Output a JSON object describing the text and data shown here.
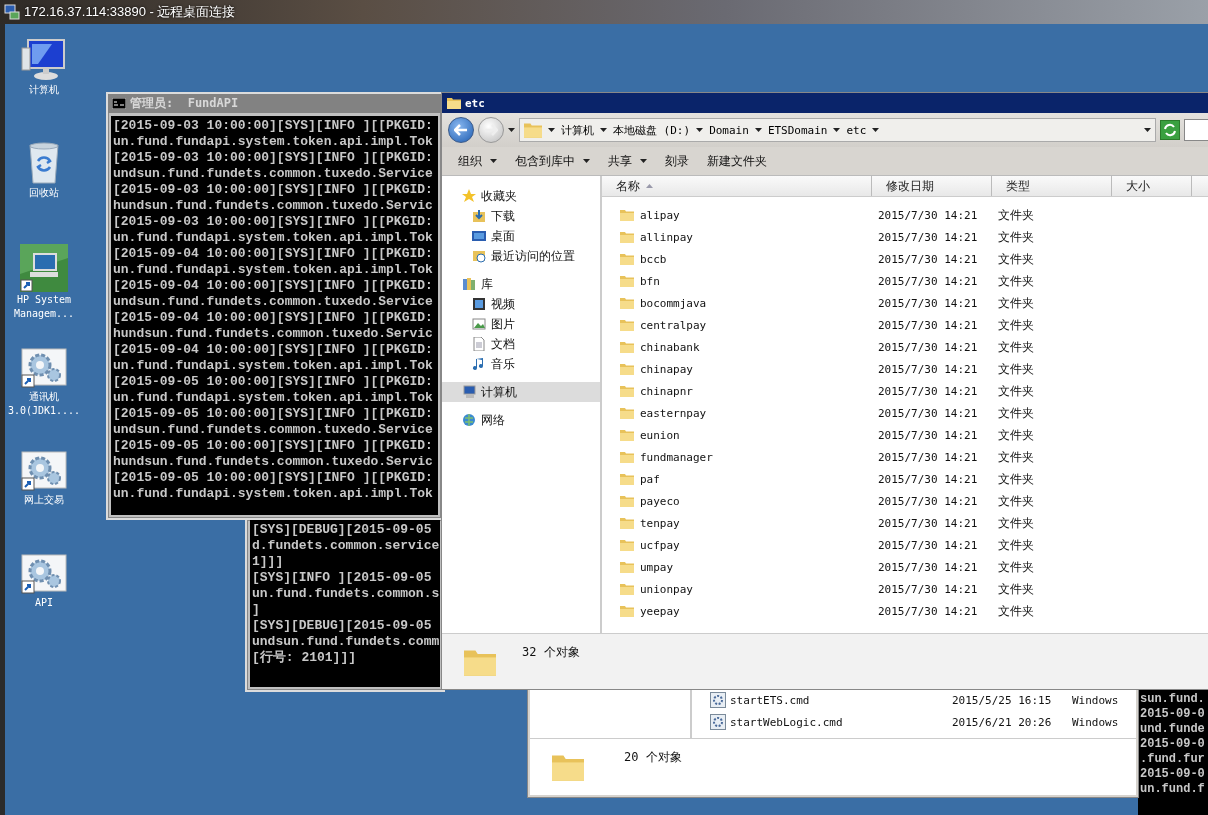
{
  "window": {
    "title": "172.16.37.114:33890 - 远程桌面连接"
  },
  "desktop_icons": [
    {
      "kind": "computer",
      "lines": [
        "计算机"
      ]
    },
    {
      "kind": "recycle",
      "lines": [
        "回收站"
      ]
    },
    {
      "kind": "hp",
      "lines": [
        "HP System",
        "Managem..."
      ]
    },
    {
      "kind": "gears",
      "lines": [
        "通讯机",
        "3.0(JDK1...."
      ]
    },
    {
      "kind": "gears",
      "lines": [
        "网上交易"
      ]
    },
    {
      "kind": "gears",
      "lines": [
        "API"
      ]
    }
  ],
  "console_back": {
    "lines": [
      "[SYS][DEBUG][2015-09-05",
      "d.fundets.common.service",
      "1]]]",
      "[SYS][INFO ][2015-09-05",
      "un.fund.fundets.common.s",
      "]",
      "[SYS][DEBUG][2015-09-05",
      "undsun.fund.fundets.comm",
      "[行号: 2101]]]"
    ]
  },
  "console_right": {
    "lines": [
      "sun.fund.",
      "2015-09-0",
      "und.funde",
      "2015-09-0",
      ".fund.fur",
      "2015-09-0",
      "un.fund.f"
    ]
  },
  "explorer_back": {
    "rows": [
      {
        "name": "startETS.cmd",
        "date": "2015/5/25 16:15",
        "type": "Windows"
      },
      {
        "name": "startWebLogic.cmd",
        "date": "2015/6/21 20:26",
        "type": "Windows"
      }
    ],
    "status": "20 个对象"
  },
  "console": {
    "title": "管理员:  FundAPI",
    "lines": [
      "[2015-09-03 10:00:00][SYS][INFO ][[PKGID:",
      "un.fund.fundapi.system.token.api.impl.Tok",
      "[2015-09-03 10:00:00][SYS][INFO ][[PKGID:",
      "undsun.fund.fundets.common.tuxedo.Service",
      "[2015-09-03 10:00:00][SYS][INFO ][[PKGID:",
      "hundsun.fund.fundets.common.tuxedo.Servic",
      "[2015-09-03 10:00:00][SYS][INFO ][[PKGID:",
      "un.fund.fundapi.system.token.api.impl.Tok",
      "[2015-09-04 10:00:00][SYS][INFO ][[PKGID:",
      "un.fund.fundapi.system.token.api.impl.Tok",
      "[2015-09-04 10:00:00][SYS][INFO ][[PKGID:",
      "undsun.fund.fundets.common.tuxedo.Service",
      "[2015-09-04 10:00:00][SYS][INFO ][[PKGID:",
      "hundsun.fund.fundets.common.tuxedo.Servic",
      "[2015-09-04 10:00:00][SYS][INFO ][[PKGID:",
      "un.fund.fundapi.system.token.api.impl.Tok",
      "[2015-09-05 10:00:00][SYS][INFO ][[PKGID:",
      "un.fund.fundapi.system.token.api.impl.Tok",
      "[2015-09-05 10:00:00][SYS][INFO ][[PKGID:",
      "undsun.fund.fundets.common.tuxedo.Service",
      "[2015-09-05 10:00:00][SYS][INFO ][[PKGID:",
      "hundsun.fund.fundets.common.tuxedo.Servic",
      "[2015-09-05 10:00:00][SYS][INFO ][[PKGID:",
      "un.fund.fundapi.system.token.api.impl.Tok"
    ]
  },
  "explorer": {
    "title": "etc",
    "breadcrumbs": [
      "计算机",
      "本地磁盘 (D:)",
      "Domain",
      "ETSDomain",
      "etc"
    ],
    "toolbar": [
      {
        "label": "组织",
        "dropdown": true
      },
      {
        "label": "包含到库中",
        "dropdown": true
      },
      {
        "label": "共享",
        "dropdown": true
      },
      {
        "label": "刻录",
        "dropdown": false
      },
      {
        "label": "新建文件夹",
        "dropdown": false
      }
    ],
    "nav": [
      {
        "kind": "star",
        "label": "收藏夹",
        "selected": false,
        "children": [
          {
            "kind": "download",
            "label": "下载",
            "selected": false
          },
          {
            "kind": "desktop",
            "label": "桌面",
            "selected": false
          },
          {
            "kind": "recent",
            "label": "最近访问的位置",
            "selected": false
          }
        ]
      },
      {
        "kind": "library",
        "label": "库",
        "selected": false,
        "children": [
          {
            "kind": "video",
            "label": "视频",
            "selected": false
          },
          {
            "kind": "image",
            "label": "图片",
            "selected": false
          },
          {
            "kind": "document",
            "label": "文档",
            "selected": false
          },
          {
            "kind": "music",
            "label": "音乐",
            "selected": false
          }
        ]
      },
      {
        "kind": "computer",
        "label": "计算机",
        "selected": true
      },
      {
        "kind": "network",
        "label": "网络",
        "selected": false
      }
    ],
    "columns": [
      {
        "label": "名称",
        "sorted": true
      },
      {
        "label": "修改日期",
        "sorted": false
      },
      {
        "label": "类型",
        "sorted": false
      },
      {
        "label": "大小",
        "sorted": false
      }
    ],
    "rows": [
      {
        "name": "alipay",
        "date": "2015/7/30 14:21",
        "type": "文件夹"
      },
      {
        "name": "allinpay",
        "date": "2015/7/30 14:21",
        "type": "文件夹"
      },
      {
        "name": "bccb",
        "date": "2015/7/30 14:21",
        "type": "文件夹"
      },
      {
        "name": "bfn",
        "date": "2015/7/30 14:21",
        "type": "文件夹"
      },
      {
        "name": "bocommjava",
        "date": "2015/7/30 14:21",
        "type": "文件夹"
      },
      {
        "name": "centralpay",
        "date": "2015/7/30 14:21",
        "type": "文件夹"
      },
      {
        "name": "chinabank",
        "date": "2015/7/30 14:21",
        "type": "文件夹"
      },
      {
        "name": "chinapay",
        "date": "2015/7/30 14:21",
        "type": "文件夹"
      },
      {
        "name": "chinapnr",
        "date": "2015/7/30 14:21",
        "type": "文件夹"
      },
      {
        "name": "easternpay",
        "date": "2015/7/30 14:21",
        "type": "文件夹"
      },
      {
        "name": "eunion",
        "date": "2015/7/30 14:21",
        "type": "文件夹"
      },
      {
        "name": "fundmanager",
        "date": "2015/7/30 14:21",
        "type": "文件夹"
      },
      {
        "name": "paf",
        "date": "2015/7/30 14:21",
        "type": "文件夹"
      },
      {
        "name": "payeco",
        "date": "2015/7/30 14:21",
        "type": "文件夹"
      },
      {
        "name": "tenpay",
        "date": "2015/7/30 14:21",
        "type": "文件夹"
      },
      {
        "name": "ucfpay",
        "date": "2015/7/30 14:21",
        "type": "文件夹"
      },
      {
        "name": "umpay",
        "date": "2015/7/30 14:21",
        "type": "文件夹"
      },
      {
        "name": "unionpay",
        "date": "2015/7/30 14:21",
        "type": "文件夹"
      },
      {
        "name": "yeepay",
        "date": "2015/7/30 14:21",
        "type": "文件夹"
      }
    ],
    "status": "32 个对象"
  }
}
